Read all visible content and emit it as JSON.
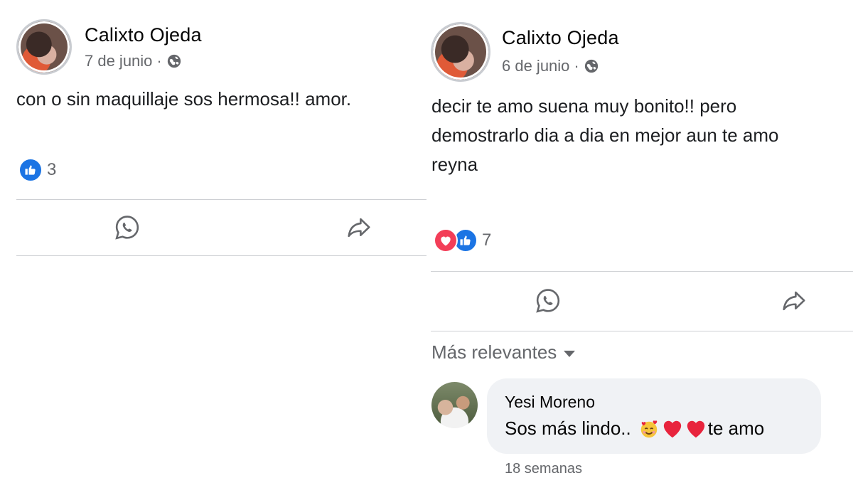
{
  "left_post": {
    "author": "Calixto Ojeda",
    "date": "7 de junio",
    "separator": "·",
    "privacy_icon": "globe-icon",
    "text": "con o sin maquillaje sos hermosa!! amor.",
    "reaction_count": "3",
    "reactions": [
      "like"
    ]
  },
  "right_post": {
    "author": "Calixto Ojeda",
    "date": "6 de junio",
    "separator": "·",
    "privacy_icon": "globe-icon",
    "text_lines": [
      "decir te amo suena muy bonito!! pero",
      "demostrarlo dia a dia en mejor aun te amo",
      "reyna"
    ],
    "reaction_count": "7",
    "reactions": [
      "love",
      "like"
    ],
    "sort_label": "Más relevantes",
    "comment": {
      "author": "Yesi Moreno",
      "text": "Sos más lindo..",
      "emojis": [
        "smiling-face-with-hearts",
        "red-heart",
        "red-heart"
      ],
      "text_after": "te amo",
      "time": "18 semanas"
    }
  },
  "colors": {
    "like": "#1b74e4",
    "love": "#f33e58",
    "secondary_text": "#65676b",
    "divider": "#ced0d4",
    "comment_bubble": "#f0f2f5"
  }
}
